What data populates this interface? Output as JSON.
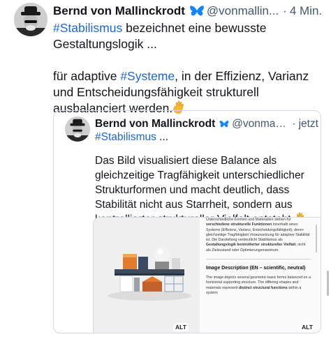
{
  "post": {
    "author_name": "Bernd von Mallinckrodt",
    "handle": "@vonmallin...",
    "separator": "·",
    "time": "4 Min.",
    "hashtag_1": "#Stabilismus",
    "text_1": " bezeichnet eine bewusste Gestaltungslogik ...",
    "text_2a": "für adaptive ",
    "hashtag_2": "#Systeme",
    "text_2b": ", in der Effizienz, Varianz und Entscheidungsfähigkeit strukturell ausbalanciert werden."
  },
  "quote": {
    "author_name": "Bernd von Mallinckrodt",
    "handle": "@vonmallinck...",
    "separator": "·",
    "time": "jetzt",
    "hashtag": "#Stabilismus",
    "hashtag_suffix": " ...",
    "body": "Das Bild visualisiert diese Balance als gleichzeitige Tragfähigkeit unterschiedlicher Strukturformen und macht deutlich, dass Stabilität nicht aus Starrheit, sondern aus kontrollierter struktureller Vielfalt entsteht."
  },
  "image_card": {
    "doc_top_p1": "Unterschiedliche Formen und Materialien stehen für ",
    "doc_top_b1": "verschiedene strukturelle Funktionen",
    "doc_top_p2": " innerhalb eines Systems (Effizienz, Varianz, Entscheidungsfähigkeit), deren gleichzeitige Tragfähigkeit Voraussetzung für adaptive Stabilität ist. Die Darstellung verdeutlicht Stabilismus als ",
    "doc_top_b2": "Gestaltungslogik kontrollierter struktureller Vielfalt",
    "doc_top_p3": ", nicht als Zielzustand oder Optimierungsmaximum.",
    "doc_heading": "Image Description (EN – scientific, neutral)",
    "doc_bottom_p1": "The image depicts several geometric basic forms balanced on a horizontal supporting structure. The differing shapes and materials represent ",
    "doc_bottom_b1": "distinct structural functions",
    "doc_bottom_p2": " within a system",
    "alt_left": "ALT",
    "alt_right": "ALT"
  },
  "colors": {
    "link": "#1d66d8",
    "muted": "#42576c",
    "border": "#d3dae3",
    "butterfly": "#1185fe"
  },
  "icons": {
    "verified": "butterfly-icon",
    "hand": "vulcan-salute-emoji"
  }
}
